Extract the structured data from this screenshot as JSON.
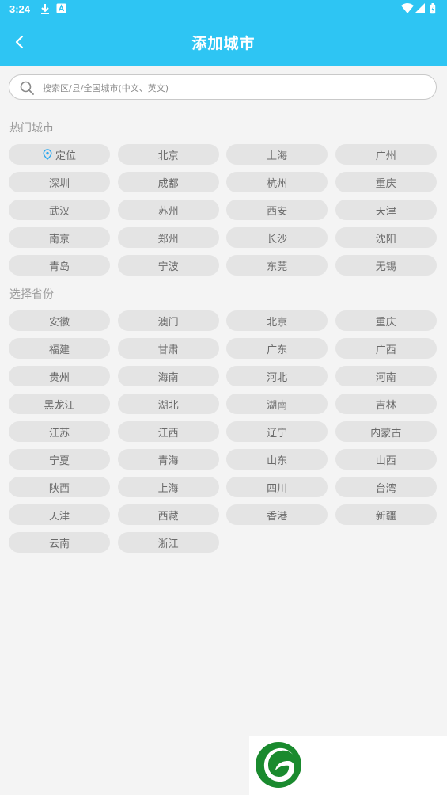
{
  "status_bar": {
    "time": "3:24",
    "left_icons": [
      "download-icon",
      "text-icon"
    ],
    "right_icons": [
      "wifi-icon",
      "signal-icon",
      "battery-icon"
    ]
  },
  "header": {
    "title": "添加城市",
    "background": "#2ec5f3"
  },
  "search": {
    "placeholder": "搜索区/县/全国城市(中文、英文)",
    "value": ""
  },
  "hot_cities": {
    "title": "热门城市",
    "items": [
      "定位",
      "北京",
      "上海",
      "广州",
      "深圳",
      "成都",
      "杭州",
      "重庆",
      "武汉",
      "苏州",
      "西安",
      "天津",
      "南京",
      "郑州",
      "长沙",
      "沈阳",
      "青岛",
      "宁波",
      "东莞",
      "无锡"
    ]
  },
  "provinces": {
    "title": "选择省份",
    "items": [
      "安徽",
      "澳门",
      "北京",
      "重庆",
      "福建",
      "甘肃",
      "广东",
      "广西",
      "贵州",
      "海南",
      "河北",
      "河南",
      "黑龙江",
      "湖北",
      "湖南",
      "吉林",
      "江苏",
      "江西",
      "辽宁",
      "内蒙古",
      "宁夏",
      "青海",
      "山东",
      "山西",
      "陕西",
      "上海",
      "四川",
      "台湾",
      "天津",
      "西藏",
      "香港",
      "新疆",
      "云南",
      "浙江"
    ]
  },
  "colors": {
    "accent": "#2ec5f3",
    "chip_bg": "#e4e4e4",
    "location_pin": "#2ea9ef",
    "logo_green": "#1a8a2e"
  }
}
